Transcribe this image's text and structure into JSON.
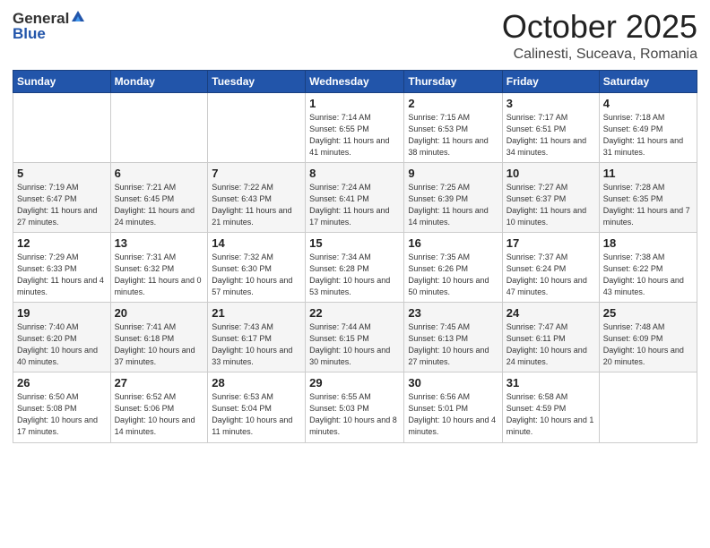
{
  "header": {
    "logo_general": "General",
    "logo_blue": "Blue",
    "month_title": "October 2025",
    "location": "Calinesti, Suceava, Romania"
  },
  "weekdays": [
    "Sunday",
    "Monday",
    "Tuesday",
    "Wednesday",
    "Thursday",
    "Friday",
    "Saturday"
  ],
  "weeks": [
    [
      {
        "day": "",
        "info": ""
      },
      {
        "day": "",
        "info": ""
      },
      {
        "day": "",
        "info": ""
      },
      {
        "day": "1",
        "info": "Sunrise: 7:14 AM\nSunset: 6:55 PM\nDaylight: 11 hours and 41 minutes."
      },
      {
        "day": "2",
        "info": "Sunrise: 7:15 AM\nSunset: 6:53 PM\nDaylight: 11 hours and 38 minutes."
      },
      {
        "day": "3",
        "info": "Sunrise: 7:17 AM\nSunset: 6:51 PM\nDaylight: 11 hours and 34 minutes."
      },
      {
        "day": "4",
        "info": "Sunrise: 7:18 AM\nSunset: 6:49 PM\nDaylight: 11 hours and 31 minutes."
      }
    ],
    [
      {
        "day": "5",
        "info": "Sunrise: 7:19 AM\nSunset: 6:47 PM\nDaylight: 11 hours and 27 minutes."
      },
      {
        "day": "6",
        "info": "Sunrise: 7:21 AM\nSunset: 6:45 PM\nDaylight: 11 hours and 24 minutes."
      },
      {
        "day": "7",
        "info": "Sunrise: 7:22 AM\nSunset: 6:43 PM\nDaylight: 11 hours and 21 minutes."
      },
      {
        "day": "8",
        "info": "Sunrise: 7:24 AM\nSunset: 6:41 PM\nDaylight: 11 hours and 17 minutes."
      },
      {
        "day": "9",
        "info": "Sunrise: 7:25 AM\nSunset: 6:39 PM\nDaylight: 11 hours and 14 minutes."
      },
      {
        "day": "10",
        "info": "Sunrise: 7:27 AM\nSunset: 6:37 PM\nDaylight: 11 hours and 10 minutes."
      },
      {
        "day": "11",
        "info": "Sunrise: 7:28 AM\nSunset: 6:35 PM\nDaylight: 11 hours and 7 minutes."
      }
    ],
    [
      {
        "day": "12",
        "info": "Sunrise: 7:29 AM\nSunset: 6:33 PM\nDaylight: 11 hours and 4 minutes."
      },
      {
        "day": "13",
        "info": "Sunrise: 7:31 AM\nSunset: 6:32 PM\nDaylight: 11 hours and 0 minutes."
      },
      {
        "day": "14",
        "info": "Sunrise: 7:32 AM\nSunset: 6:30 PM\nDaylight: 10 hours and 57 minutes."
      },
      {
        "day": "15",
        "info": "Sunrise: 7:34 AM\nSunset: 6:28 PM\nDaylight: 10 hours and 53 minutes."
      },
      {
        "day": "16",
        "info": "Sunrise: 7:35 AM\nSunset: 6:26 PM\nDaylight: 10 hours and 50 minutes."
      },
      {
        "day": "17",
        "info": "Sunrise: 7:37 AM\nSunset: 6:24 PM\nDaylight: 10 hours and 47 minutes."
      },
      {
        "day": "18",
        "info": "Sunrise: 7:38 AM\nSunset: 6:22 PM\nDaylight: 10 hours and 43 minutes."
      }
    ],
    [
      {
        "day": "19",
        "info": "Sunrise: 7:40 AM\nSunset: 6:20 PM\nDaylight: 10 hours and 40 minutes."
      },
      {
        "day": "20",
        "info": "Sunrise: 7:41 AM\nSunset: 6:18 PM\nDaylight: 10 hours and 37 minutes."
      },
      {
        "day": "21",
        "info": "Sunrise: 7:43 AM\nSunset: 6:17 PM\nDaylight: 10 hours and 33 minutes."
      },
      {
        "day": "22",
        "info": "Sunrise: 7:44 AM\nSunset: 6:15 PM\nDaylight: 10 hours and 30 minutes."
      },
      {
        "day": "23",
        "info": "Sunrise: 7:45 AM\nSunset: 6:13 PM\nDaylight: 10 hours and 27 minutes."
      },
      {
        "day": "24",
        "info": "Sunrise: 7:47 AM\nSunset: 6:11 PM\nDaylight: 10 hours and 24 minutes."
      },
      {
        "day": "25",
        "info": "Sunrise: 7:48 AM\nSunset: 6:09 PM\nDaylight: 10 hours and 20 minutes."
      }
    ],
    [
      {
        "day": "26",
        "info": "Sunrise: 6:50 AM\nSunset: 5:08 PM\nDaylight: 10 hours and 17 minutes."
      },
      {
        "day": "27",
        "info": "Sunrise: 6:52 AM\nSunset: 5:06 PM\nDaylight: 10 hours and 14 minutes."
      },
      {
        "day": "28",
        "info": "Sunrise: 6:53 AM\nSunset: 5:04 PM\nDaylight: 10 hours and 11 minutes."
      },
      {
        "day": "29",
        "info": "Sunrise: 6:55 AM\nSunset: 5:03 PM\nDaylight: 10 hours and 8 minutes."
      },
      {
        "day": "30",
        "info": "Sunrise: 6:56 AM\nSunset: 5:01 PM\nDaylight: 10 hours and 4 minutes."
      },
      {
        "day": "31",
        "info": "Sunrise: 6:58 AM\nSunset: 4:59 PM\nDaylight: 10 hours and 1 minute."
      },
      {
        "day": "",
        "info": ""
      }
    ]
  ]
}
